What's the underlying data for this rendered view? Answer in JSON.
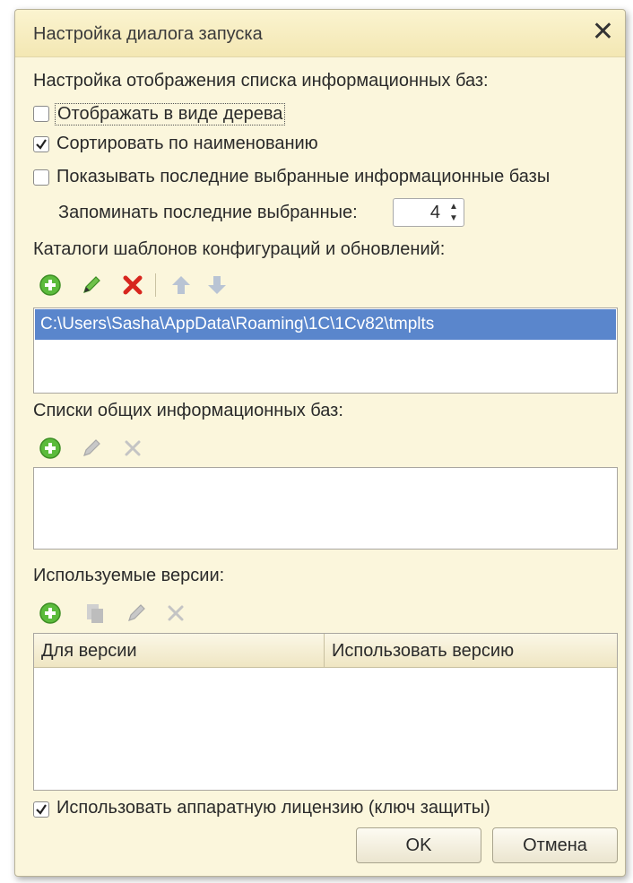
{
  "window": {
    "title": "Настройка диалога запуска",
    "close_glyph": "✕"
  },
  "display": {
    "heading": "Настройка отображения списка информационных баз:",
    "tree_label": "Отображать в виде дерева",
    "tree_checked": false,
    "sort_label": "Сортировать по наименованию",
    "sort_checked": true,
    "recent_label": "Показывать последние выбранные информационные базы",
    "recent_checked": false,
    "remember_label": "Запоминать последние выбранные:",
    "remember_value": "4"
  },
  "templates": {
    "heading": "Каталоги шаблонов конфигураций и обновлений:",
    "toolbar_icons": [
      "add-icon",
      "edit-icon",
      "delete-icon",
      "move-up-icon",
      "move-down-icon"
    ],
    "items": [
      "C:\\Users\\Sasha\\AppData\\Roaming\\1C\\1Cv82\\tmplts"
    ]
  },
  "shared_lists": {
    "heading": "Списки общих информационных баз:",
    "toolbar_icons": [
      "add-icon",
      "edit-icon",
      "delete-icon"
    ]
  },
  "versions": {
    "heading": "Используемые версии:",
    "toolbar_icons": [
      "add-icon",
      "copy-icon",
      "edit-icon",
      "delete-icon"
    ],
    "columns": [
      "Для версии",
      "Использовать версию"
    ]
  },
  "license": {
    "label": "Использовать аппаратную лицензию (ключ защиты)",
    "checked": true
  },
  "buttons": {
    "ok": "OK",
    "cancel": "Отмена"
  },
  "colors": {
    "dialog_bg": "#fbf6dc",
    "selection": "#5a86cc",
    "add_green": "#5bbb3c",
    "delete_red": "#d7261e"
  }
}
